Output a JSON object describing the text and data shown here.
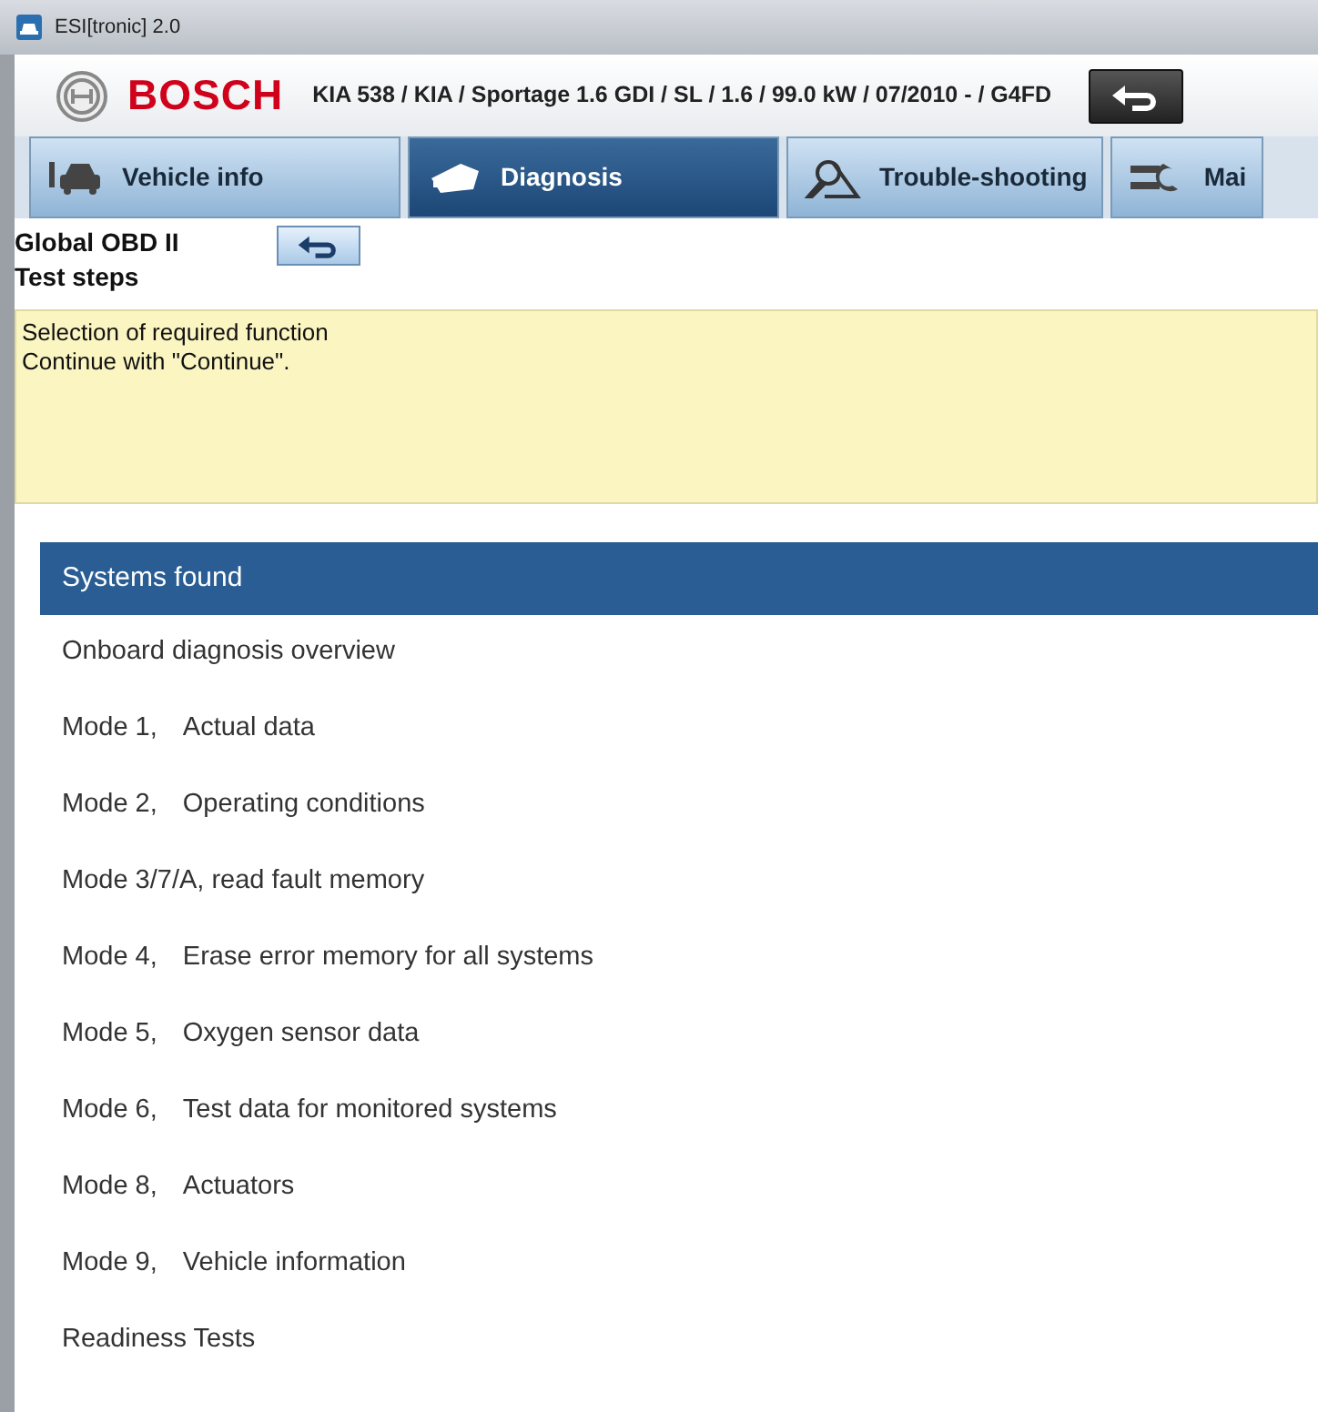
{
  "window": {
    "title": "ESI[tronic] 2.0"
  },
  "header": {
    "brand": "BOSCH",
    "vehicle": "KIA 538 / KIA / Sportage 1.6 GDI / SL / 1.6 / 99.0 kW / 07/2010 - / G4FD"
  },
  "tabs": [
    {
      "label": "Vehicle info",
      "selected": false
    },
    {
      "label": "Diagnosis",
      "selected": true
    },
    {
      "label": "Trouble-shooting",
      "selected": false
    },
    {
      "label": "Mai",
      "selected": false
    }
  ],
  "section": {
    "title": "Global OBD II",
    "subtitle": "Test steps"
  },
  "instructions": [
    "Selection of required function",
    "Continue with \"Continue\"."
  ],
  "list": {
    "header": "Systems found",
    "items": [
      {
        "label": "Onboard diagnosis overview"
      },
      {
        "code": "Mode 1,",
        "label": "Actual data"
      },
      {
        "code": "Mode 2,",
        "label": "Operating conditions"
      },
      {
        "label": "Mode 3/7/A, read fault memory"
      },
      {
        "code": "Mode 4,",
        "label": "Erase error memory for all systems"
      },
      {
        "code": "Mode 5,",
        "label": "Oxygen sensor data"
      },
      {
        "code": "Mode 6,",
        "label": "Test data for monitored systems"
      },
      {
        "code": "Mode 8,",
        "label": "Actuators"
      },
      {
        "code": "Mode 9,",
        "label": "Vehicle information"
      },
      {
        "label": "Readiness Tests"
      }
    ]
  }
}
